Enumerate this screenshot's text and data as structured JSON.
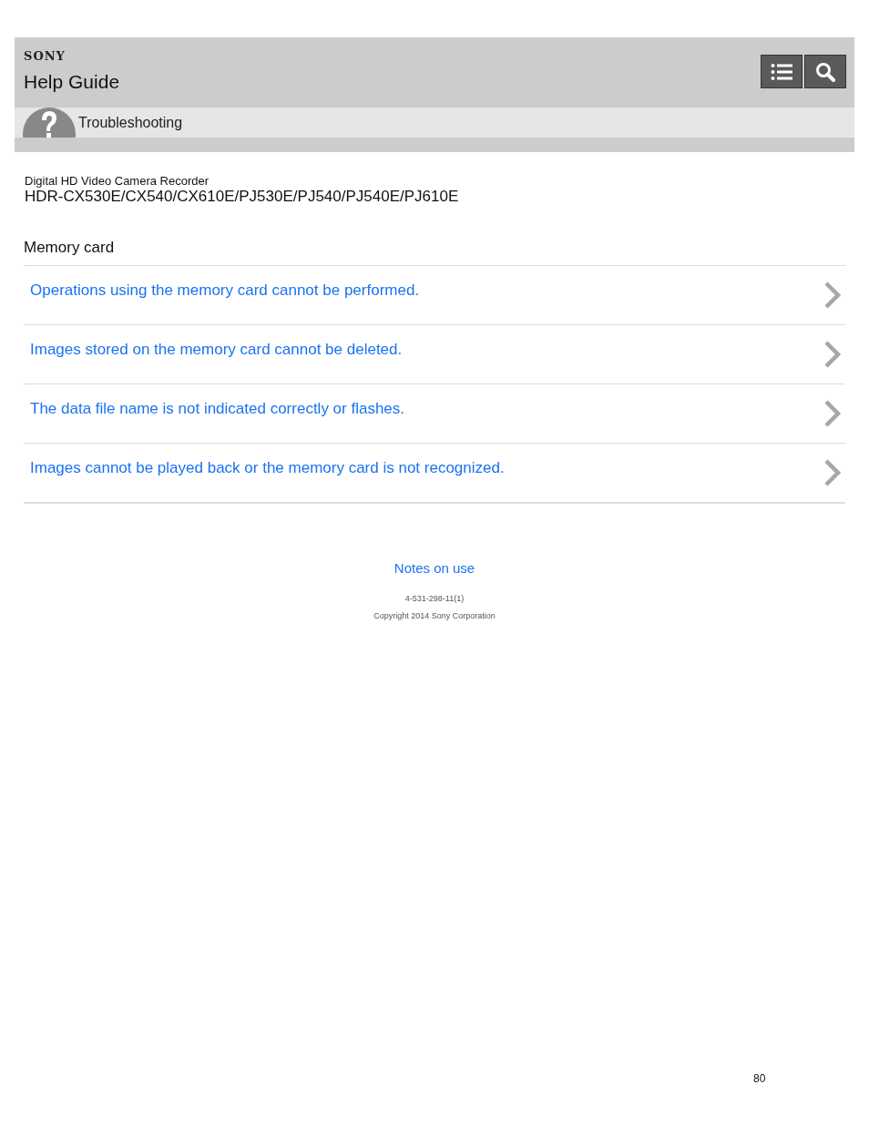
{
  "header": {
    "brand": "SONY",
    "title": "Help Guide"
  },
  "breadcrumb": {
    "label": "Troubleshooting"
  },
  "product": {
    "category": "Digital HD Video Camera Recorder",
    "models": "HDR-CX530E/CX540/CX610E/PJ530E/PJ540/PJ540E/PJ610E"
  },
  "section": {
    "title": "Memory card",
    "links": [
      {
        "label": "Operations using the memory card cannot be performed."
      },
      {
        "label": "Images stored on the memory card cannot be deleted."
      },
      {
        "label": "The data file name is not indicated correctly or flashes."
      },
      {
        "label": "Images cannot be played back or the memory card is not recognized."
      }
    ]
  },
  "footer": {
    "link": "Notes on use",
    "code": "4-531-298-11(1)",
    "copyright": "Copyright 2014 Sony Corporation"
  },
  "page_number": "80"
}
